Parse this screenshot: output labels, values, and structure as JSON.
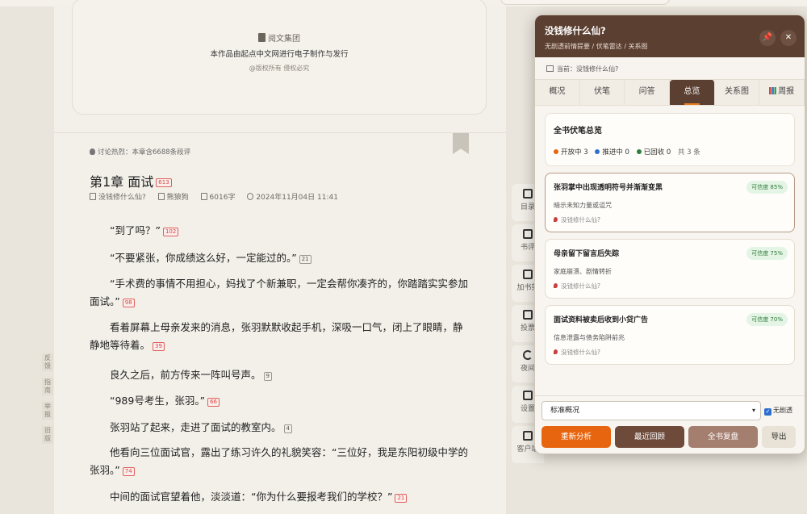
{
  "copyright": {
    "publisher": "阅文集团",
    "statement": "本作品由起点中文网进行电子制作与发行",
    "rights": "@版权所有 侵权必究"
  },
  "side_tabs": [
    "反馈",
    "指南",
    "举报",
    "旧版"
  ],
  "chapter": {
    "hot": "讨论热烈：本章含6688条段评",
    "title": "第1章 面试",
    "title_badge": "613",
    "book": "没钱修什么仙?",
    "author": "熊狼狗",
    "words": "6016字",
    "date": "2024年11月04日 11:41"
  },
  "paragraphs": [
    {
      "text": "“到了吗？”",
      "badge": "102",
      "hot": true
    },
    {
      "text": "“不要紧张，你成绩这么好，一定能过的。”",
      "badge": "21",
      "hot": false
    },
    {
      "text": "“手术费的事情不用担心，妈找了个新兼职，一定会帮你凑齐的，你踏踏实实参加面试。”",
      "badge": "98",
      "hot": true
    },
    {
      "text": "看着屏幕上母亲发来的消息，张羽默默收起手机，深吸一口气，闭上了眼睛，静静地等待着。",
      "badge": "39",
      "hot": true
    },
    {
      "text": "良久之后，前方传来一阵叫号声。",
      "badge": "9",
      "hot": false
    },
    {
      "text": "“989号考生，张羽。”",
      "badge": "66",
      "hot": true
    },
    {
      "text": "张羽站了起来，走进了面试的教室内。",
      "badge": "4",
      "hot": false
    },
    {
      "text": "他看向三位面试官，露出了练习许久的礼貌笑容：“三位好，我是东阳初级中学的张羽。”",
      "badge": "74",
      "hot": true
    },
    {
      "text": "中间的面试官望着他，淡淡道：“你为什么要报考我们的学校？”",
      "badge": "21",
      "hot": true
    }
  ],
  "toolbar": [
    {
      "label": "目录",
      "icon": "list-icon"
    },
    {
      "label": "书评",
      "icon": "book-icon"
    },
    {
      "label": "加书架",
      "icon": "shelf-icon"
    },
    {
      "label": "投票",
      "icon": "ticket-icon"
    },
    {
      "label": "夜间",
      "icon": "moon-icon"
    },
    {
      "label": "设置",
      "icon": "settings-icon"
    },
    {
      "label": "客户端",
      "icon": "phone-icon"
    }
  ],
  "panel": {
    "title": "没钱修什么仙?",
    "subtitle": "无剧透前情提要 / 伏笔雷达 / 关系图",
    "current_label": "当前：没钱修什么仙?",
    "tabs": [
      "概况",
      "伏笔",
      "问答",
      "总览",
      "关系图",
      "周报"
    ],
    "active_tab": 3,
    "summary": {
      "title": "全书伏笔总览",
      "open": "开放中 3",
      "advancing": "推进中 0",
      "recovered": "已回收 0",
      "total": "共 3 条"
    },
    "cards": [
      {
        "title": "张羽掌中出现透明符号并渐渐变黑",
        "confidence": "可信度 85%",
        "desc": "暗示未知力量或诅咒",
        "source": "没钱修什么仙?"
      },
      {
        "title": "母亲留下留言后失踪",
        "confidence": "可信度 75%",
        "desc": "家庭崩溃、剧情转折",
        "source": "没钱修什么仙?"
      },
      {
        "title": "面试资料被卖后收到小贷广告",
        "confidence": "可信度 70%",
        "desc": "信息泄露与债务陷阱前兆",
        "source": "没钱修什么仙?"
      }
    ],
    "select_value": "标准概况",
    "checkbox_label": "无剧透",
    "buttons": [
      "重新分析",
      "最近回顾",
      "全书复盘",
      "导出"
    ]
  },
  "colors": {
    "panel_header": "#5b3f31",
    "accent_orange": "#e8650f",
    "open_dot": "#e8650f",
    "advancing_dot": "#2d6fd1",
    "recovered_dot": "#2f7d3a"
  }
}
